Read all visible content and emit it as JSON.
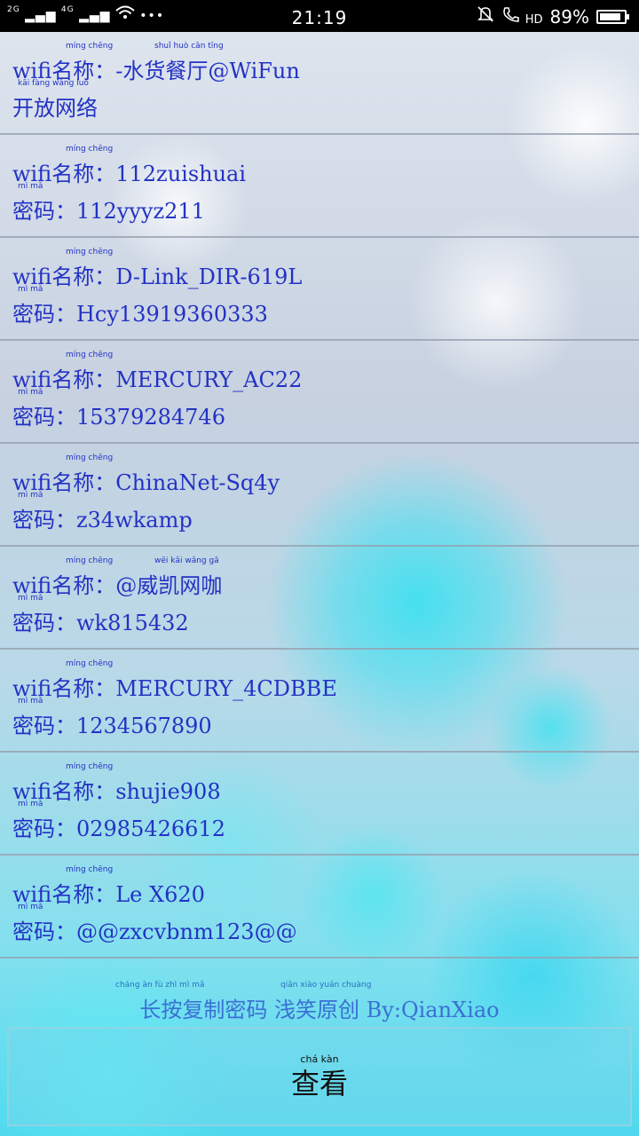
{
  "status_bar": {
    "network_1": "2G",
    "network_2": "4G",
    "signal_glyph": "▂▄▆",
    "dots": "•••",
    "time": "21:19",
    "hd_label": "HD",
    "battery_text": "89%",
    "battery_level": 0.89
  },
  "networks": [
    {
      "ssid_prefix": "wifi名称：",
      "ssid": "-水货餐厅@WiFun",
      "second_line": "开放网络",
      "pinyin_name": "míng chēng",
      "pinyin_extra": "shuǐ huò cān tīng",
      "pinyin_second": "kāi fàng wǎng luò"
    },
    {
      "ssid_prefix": "wifi名称：",
      "ssid": "112zuishuai",
      "second_line": "密码：112yyyz211",
      "pinyin_name": "míng chēng",
      "pinyin_second": "mì mǎ"
    },
    {
      "ssid_prefix": "wifi名称：",
      "ssid": "D-Link_DIR-619L",
      "second_line": "密码：Hcy13919360333",
      "pinyin_name": "míng chēng",
      "pinyin_second": "mì mǎ"
    },
    {
      "ssid_prefix": "wifi名称：",
      "ssid": "MERCURY_AC22",
      "second_line": "密码：15379284746",
      "pinyin_name": "míng chēng",
      "pinyin_second": "mì mǎ"
    },
    {
      "ssid_prefix": "wifi名称：",
      "ssid": "ChinaNet-Sq4y",
      "second_line": "密码：z34wkamp",
      "pinyin_name": "míng chēng",
      "pinyin_second": "mì mǎ"
    },
    {
      "ssid_prefix": "wifi名称：",
      "ssid": "@威凯网咖",
      "second_line": "密码：wk815432",
      "pinyin_name": "míng chēng",
      "pinyin_extra": "wēi kǎi wǎng gā",
      "pinyin_second": "mì mǎ"
    },
    {
      "ssid_prefix": "wifi名称：",
      "ssid": "MERCURY_4CDBBE",
      "second_line": "密码：1234567890",
      "pinyin_name": "míng chēng",
      "pinyin_second": "mì mǎ"
    },
    {
      "ssid_prefix": "wifi名称：",
      "ssid": "shujie908",
      "second_line": "密码：02985426612",
      "pinyin_name": "míng chēng",
      "pinyin_second": "mì mǎ"
    },
    {
      "ssid_prefix": "wifi名称：",
      "ssid": "Le X620",
      "second_line": "密码：@@zxcvbnm123@@",
      "pinyin_name": "míng chēng",
      "pinyin_second": "mì mǎ"
    }
  ],
  "footer": {
    "note": "长按复制密码 浅笑原创 By:QianXiao",
    "pinyin_1": "cháng àn fù zhì mì mǎ",
    "pinyin_2": "qiǎn xiào yuán chuàng"
  },
  "view_button": {
    "label": "查看",
    "pinyin": "chá kàn"
  },
  "colors": {
    "text_blue": "#2332c4",
    "footer_blue": "#3a6fd4",
    "status_bg": "#000000"
  }
}
